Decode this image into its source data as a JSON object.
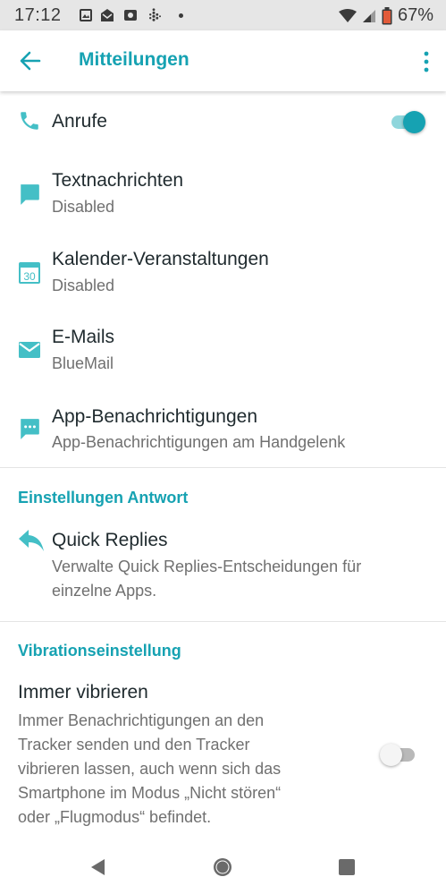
{
  "status_bar": {
    "time": "17:12",
    "battery_percent": "67%",
    "icons": [
      "photo-notification-icon",
      "mail-notification-icon",
      "image-notification-icon",
      "fitbit-icon",
      "wifi-icon",
      "signal-icon",
      "battery-icon"
    ]
  },
  "app_bar": {
    "title": "Mitteilungen"
  },
  "notifications": {
    "calls": {
      "label": "Anrufe",
      "enabled": true
    },
    "texts": {
      "label": "Textnachrichten",
      "status": "Disabled"
    },
    "calendar": {
      "label": "Kalender-Veranstaltungen",
      "status": "Disabled",
      "icon_day": "30"
    },
    "email": {
      "label": "E-Mails",
      "status": "BlueMail"
    },
    "apps": {
      "label": "App-Benachrichtigungen",
      "status": "App-Benachrichtigungen am Handgelenk"
    }
  },
  "reply_section": {
    "header": "Einstellungen Antwort",
    "quick_replies": {
      "label": "Quick Replies",
      "line1": "Verwalte Quick Replies-Entscheidungen für",
      "line2": "einzelne Apps."
    }
  },
  "vibration_section": {
    "header": "Vibrationseinstellung",
    "always_vibrate": {
      "label": "Immer vibrieren",
      "lines": [
        "Immer Benachrichtigungen an den",
        "Tracker senden und den Tracker",
        "vibrieren lassen, auch wenn sich das",
        "Smartphone im Modus „Nicht stören“",
        "oder „Flugmodus“ befindet."
      ],
      "enabled": false
    }
  },
  "colors": {
    "accent": "#16a2b2",
    "icon": "#44bfc6",
    "toggle_on_track": "#8fd6dc",
    "toggle_off_track": "#b9b9b9",
    "toggle_off_thumb": "#f5f5f5"
  }
}
